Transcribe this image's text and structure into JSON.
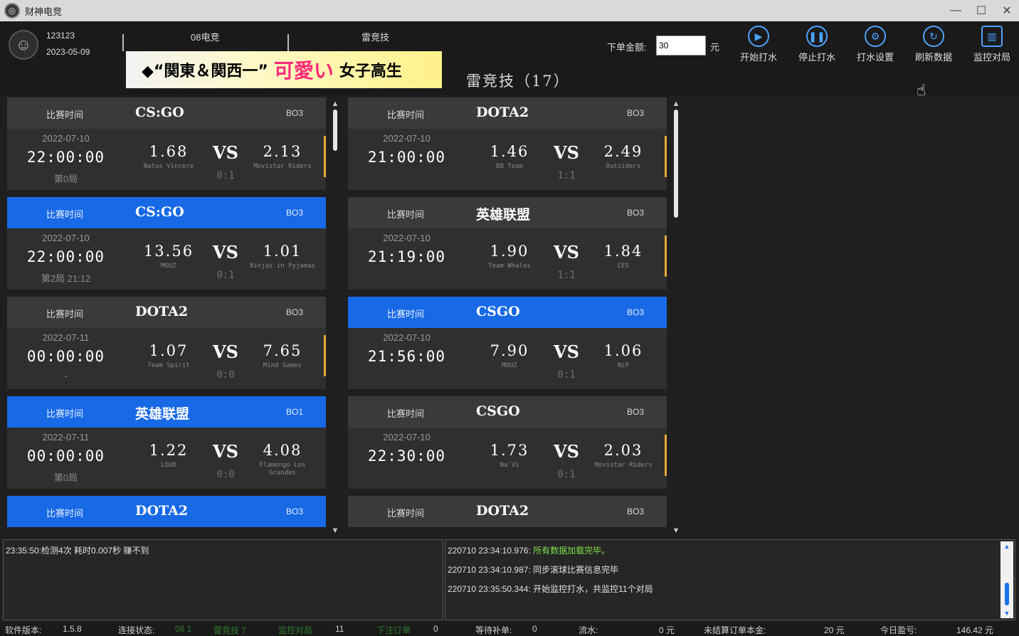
{
  "window": {
    "title": "财神电竞"
  },
  "user": {
    "id": "123123",
    "date": "2023-05-09"
  },
  "tabs": [
    {
      "label": "08电竞"
    },
    {
      "label": "雷竞技"
    }
  ],
  "banner": {
    "left": "◆“関東＆関西一”",
    "pink": "可愛い",
    "right": "女子高生"
  },
  "section_title": "雷竞技（17）",
  "order": {
    "label": "下单金额:",
    "value": "30",
    "unit": "元"
  },
  "toolbar": [
    {
      "label": "开始打水",
      "icon": "play-icon"
    },
    {
      "label": "停止打水",
      "icon": "pause-icon"
    },
    {
      "label": "打水设置",
      "icon": "gear-icon"
    },
    {
      "label": "刷新数据",
      "icon": "refresh-icon"
    },
    {
      "label": "监控对局",
      "icon": "monitor-icon"
    }
  ],
  "time_label": "比赛时间",
  "vs_label": "VS",
  "left_matches": [
    {
      "game": "CS:GO",
      "bo": "BO3",
      "date": "2022-07-10",
      "time": "22:00:00",
      "stage": "第0局",
      "odds1": "1.68",
      "team1": "Natus Vincere",
      "odds2": "2.13",
      "team2": "Movistar Riders",
      "score": "0:1",
      "active": false
    },
    {
      "game": "CS:GO",
      "bo": "BO3",
      "date": "2022-07-10",
      "time": "22:00:00",
      "stage": "第2局 21:12",
      "odds1": "13.56",
      "team1": "MOUZ",
      "odds2": "1.01",
      "team2": "Ninjas in Pyjamas",
      "score": "0:1",
      "active": true
    },
    {
      "game": "DOTA2",
      "bo": "BO3",
      "date": "2022-07-11",
      "time": "00:00:00",
      "stage": "-",
      "odds1": "1.07",
      "team1": "Team Spirit",
      "odds2": "7.65",
      "team2": "Mind Games",
      "score": "0:0",
      "active": false
    },
    {
      "game": "英雄联盟",
      "bo": "BO1",
      "date": "2022-07-11",
      "time": "00:00:00",
      "stage": "第0局",
      "odds1": "1.22",
      "team1": "LOUD",
      "odds2": "4.08",
      "team2": "Flamengo Los Grandes",
      "score": "0:0",
      "active": true
    },
    {
      "game": "DOTA2",
      "bo": "BO3",
      "active": true,
      "partial": true
    }
  ],
  "right_matches": [
    {
      "game": "DOTA2",
      "bo": "BO3",
      "date": "2022-07-10",
      "time": "21:00:00",
      "stage": "",
      "odds1": "1.46",
      "team1": "BB Team",
      "odds2": "2.49",
      "team2": "Outsiders",
      "score": "1:1",
      "active": false
    },
    {
      "game": "英雄联盟",
      "bo": "BO3",
      "date": "2022-07-10",
      "time": "21:19:00",
      "stage": "",
      "odds1": "1.90",
      "team1": "Team Whales",
      "odds2": "1.84",
      "team2": "CES",
      "score": "1:1",
      "active": false
    },
    {
      "game": "CSGO",
      "bo": "BO3",
      "date": "2022-07-10",
      "time": "21:56:00",
      "stage": "",
      "odds1": "7.90",
      "team1": "MOUZ",
      "odds2": "1.06",
      "team2": "NiP",
      "score": "0:1",
      "active": true
    },
    {
      "game": "CSGO",
      "bo": "BO3",
      "date": "2022-07-10",
      "time": "22:30:00",
      "stage": "",
      "odds1": "1.73",
      "team1": "Na`Vi",
      "odds2": "2.03",
      "team2": "Movistar Riders",
      "score": "0:1",
      "active": false
    },
    {
      "game": "DOTA2",
      "bo": "BO3",
      "active": false,
      "partial": true
    }
  ],
  "log_left": "23:35:50:检测4次 耗时0.007秒 赚不到",
  "log_right": [
    {
      "ts": "220710 23:34:10.976:",
      "msg": "所有数据加载完毕。",
      "green": true
    },
    {
      "ts": "220710 23:34:10.987:",
      "msg": "同步滚球比赛信息完毕",
      "green": false
    },
    {
      "ts": "220710 23:35:50.344:",
      "msg": "开始监控打水，共监控11个对局",
      "green": false
    }
  ],
  "status": {
    "version_label": "软件版本:",
    "version": "1.5.8",
    "conn_label": "连接状态:",
    "conn1": "08 1",
    "conn2": "雷竞技 7",
    "monitor_label": "监控对局",
    "monitor": "11",
    "order_label": "下注订单",
    "order": "0",
    "wait_label": "等待补单:",
    "wait": "0",
    "flow_label": "流水:",
    "flow": "0 元",
    "unsettled_label": "未结算订单本金:",
    "unsettled": "20 元",
    "profit_label": "今日盈亏:",
    "profit": "146.42 元"
  }
}
